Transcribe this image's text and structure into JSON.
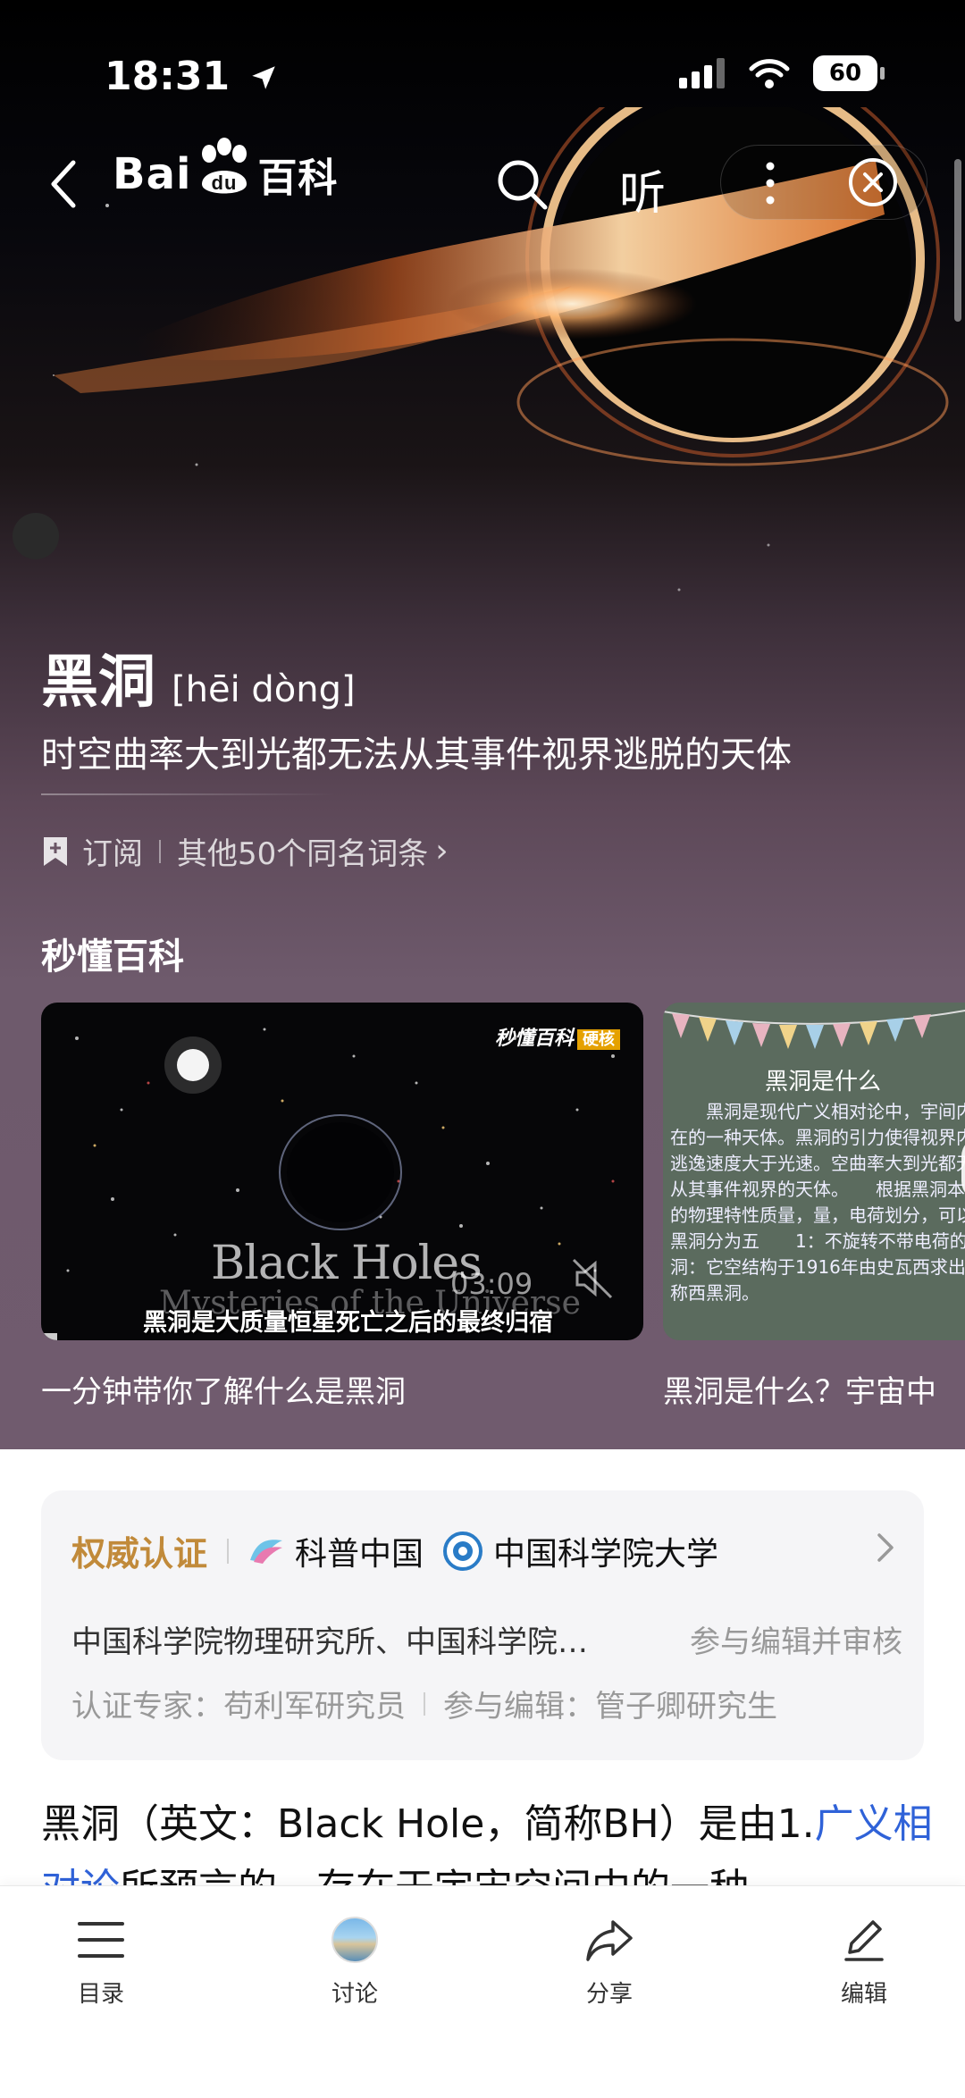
{
  "status_bar": {
    "time": "18:31",
    "battery": "60"
  },
  "nav": {
    "logo_text_left": "Bai",
    "logo_text_paw": "du",
    "logo_text_right": "百科",
    "listen_label": "听"
  },
  "entry": {
    "title": "黑洞",
    "pinyin": "[hēi dòng]",
    "subtitle": "时空曲率大到光都无法从其事件视界逃脱的天体",
    "subscribe": "订阅",
    "same_name": "其他50个同名词条",
    "same_name_chevron": "›"
  },
  "quick_section": {
    "title": "秒懂百科",
    "videos": [
      {
        "caption": "一分钟带你了解什么是黑洞",
        "brand": "秒懂百科",
        "brand_badge": "硬核",
        "overlay_en": "Black Holes",
        "overlay_en2": "Mysteries of the Universe",
        "duration": "03:09",
        "subtitle": "黑洞是大质量恒星死亡之后的最终归宿"
      },
      {
        "caption": "黑洞是什么？宇宙中",
        "chalk_title": "黑洞是什么",
        "chalk_text": "　　黑洞是现代广义相对论中，宇间内存在的一种天体。黑洞的引力使得视界内的逃逸速度大于光速。空曲率大到光都无法从其事件视界的天体。　　根据黑洞本身的物理特性质量，量，电荷划分，可以将黑洞分为五　　1：不旋转不带电荷的黑洞：它空结构于1916年由史瓦西求出，称西黑洞。"
      }
    ]
  },
  "authority": {
    "label": "权威认证",
    "org1": "科普中国",
    "org2": "中国科学院大学",
    "line2_left": "中国科学院物理研究所、中国科学院…",
    "line2_right": "参与编辑并审核",
    "expert": "认证专家：苟利军研究员",
    "editor": "参与编辑：管子卿研究生"
  },
  "body": {
    "text_before": "黑洞（英文：Black Hole，简称BH）是由1.",
    "link": "广义相对论",
    "text_after": "所预言的，存在于宇宙空间中的一种"
  },
  "bottom_tabs": [
    {
      "label": "目录",
      "icon": "list-icon"
    },
    {
      "label": "讨论",
      "icon": "avatar-icon"
    },
    {
      "label": "分享",
      "icon": "share-icon"
    },
    {
      "label": "编辑",
      "icon": "edit-icon"
    }
  ],
  "colors": {
    "authority_gold": "#c18a3a",
    "link_blue": "#2f62d8"
  }
}
